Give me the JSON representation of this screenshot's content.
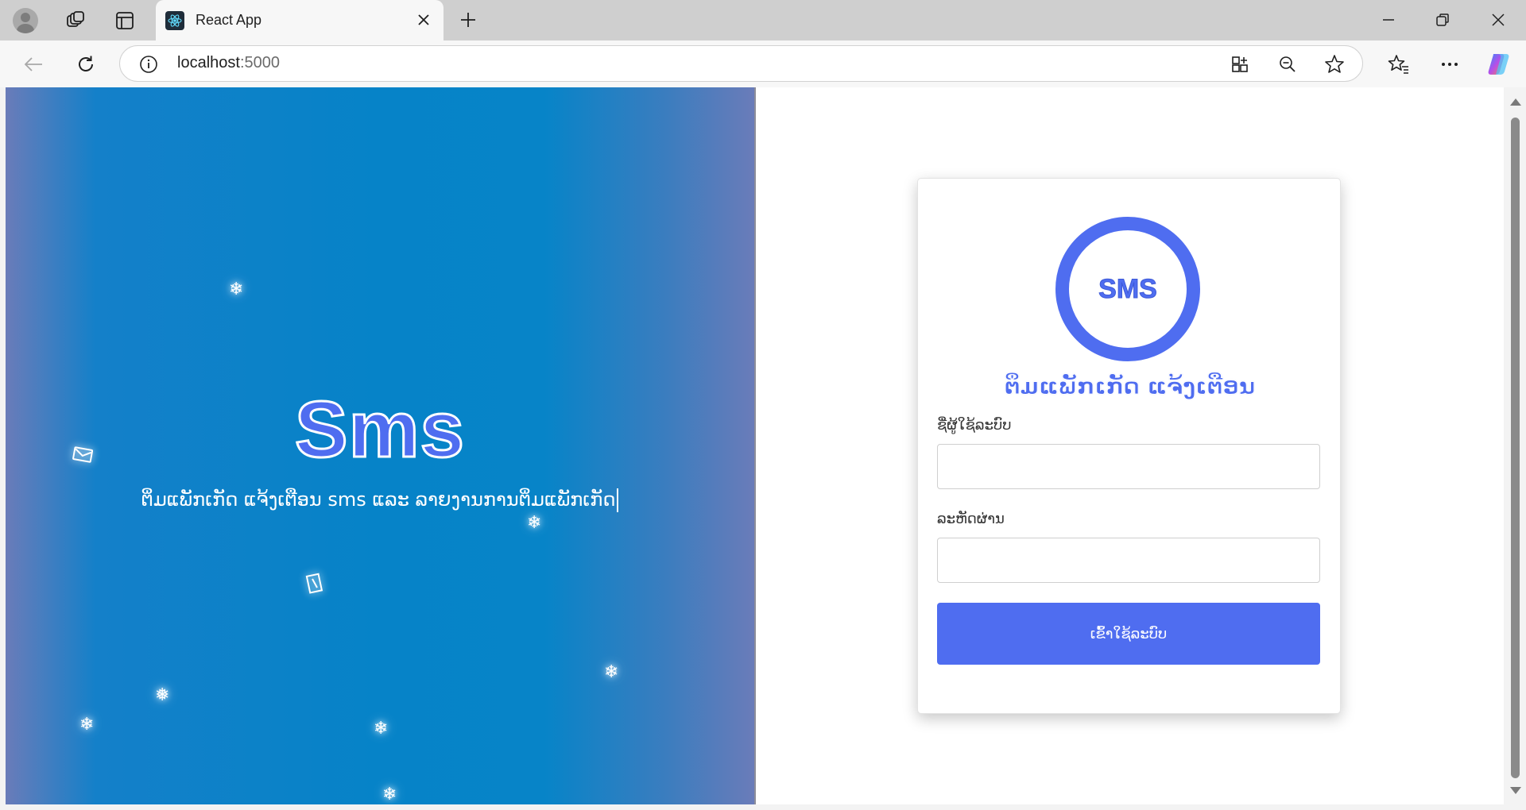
{
  "browser": {
    "tab_title": "React App",
    "url_host": "localhost",
    "url_port": ":5000",
    "icons": {
      "profile": "avatar-icon",
      "workspaces": "workspaces-icon",
      "vertical_tabs": "vertical-tabs-icon",
      "tab_favicon": "react-icon",
      "tab_close": "close-icon",
      "new_tab": "plus-icon",
      "minimize": "minimize-icon",
      "restore": "restore-icon",
      "close": "close-icon",
      "back": "arrow-left-icon",
      "reload": "reload-icon",
      "site_info": "info-icon",
      "apps": "apps-icon",
      "zoom": "zoom-out-icon",
      "favorite": "star-icon",
      "favorites": "favorites-icon",
      "more": "more-icon",
      "copilot": "copilot-icon"
    }
  },
  "hero": {
    "title": "Sms",
    "subtitle": "ຕິ່ມແພັກເກັດ ແຈ້ງເຕືອນ sms ແລະ ລາຍງານການຕິ່ມແພັກເກັດ"
  },
  "login": {
    "logo_text": "SMS",
    "brand": "ຕິ່ມແພັກເກັດ ແຈ້ງເຕືອນ",
    "username_label": "ຊື່ຜູ້ໃຊ້ລະບົບ",
    "username_value": "",
    "password_label": "ລະຫັດຜ່ານ",
    "password_value": "",
    "submit_label": "ເຂົ້າໃຊ້ລະບົບ"
  },
  "colors": {
    "accent": "#4f6df0",
    "hero_gradient_center": "#0683c8",
    "hero_gradient_edge": "#6a7cb9"
  },
  "floating_icons": [
    "snowflake-icon",
    "envelope-icon",
    "snowflake-icon",
    "card-icon",
    "snowflake-icon",
    "snowflake-icon",
    "snowflake-icon",
    "snowflake-icon",
    "snowflake-icon"
  ]
}
